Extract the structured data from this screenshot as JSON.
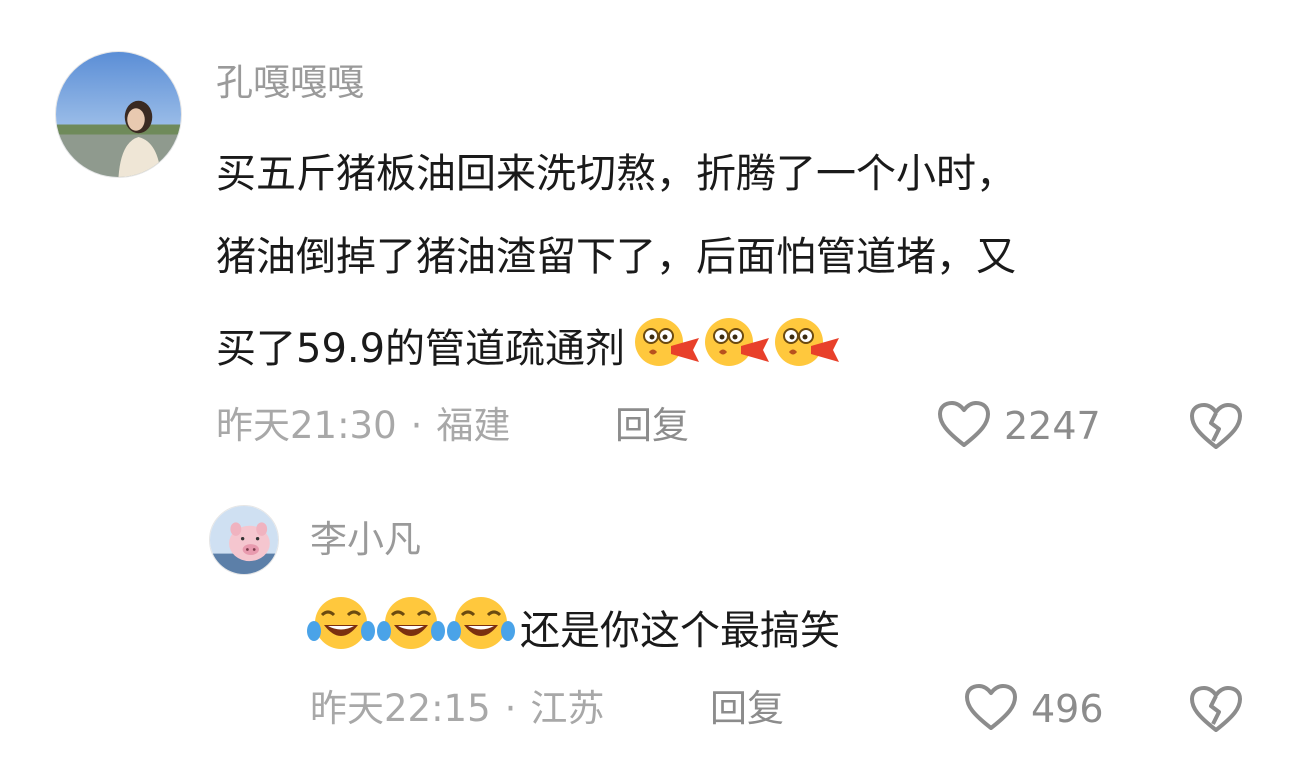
{
  "comments": [
    {
      "username": "孔嘎嘎嘎",
      "content_lines": [
        "买五斤猪板油回来洗切熬，折腾了一个小时，",
        "猪油倒掉了猪油渣留下了，后面怕管道堵，又",
        "买了59.9的管道疏通剂"
      ],
      "trailing_emojis": [
        "drooling-face-emoji",
        "drooling-face-emoji",
        "drooling-face-emoji"
      ],
      "time": "昨天21:30",
      "separator": "·",
      "location": "福建",
      "reply_label": "回复",
      "likes": "2247",
      "icons": {
        "like": "heart-outline-icon",
        "dislike": "broken-heart-icon"
      }
    },
    {
      "username": "李小凡",
      "leading_emojis": [
        "laughing-crying-emoji",
        "laughing-crying-emoji",
        "laughing-crying-emoji"
      ],
      "content": "还是你这个最搞笑",
      "time": "昨天22:15",
      "separator": "·",
      "location": "江苏",
      "reply_label": "回复",
      "likes": "496",
      "icons": {
        "like": "heart-outline-icon",
        "dislike": "broken-heart-icon"
      }
    }
  ],
  "colors": {
    "username": "#9a9a9a",
    "content": "#1a1a1a",
    "meta": "#a8a8a8",
    "icon": "#8c8c8c",
    "emoji_yellow": "#ffc83d",
    "emoji_red": "#e8402a"
  }
}
